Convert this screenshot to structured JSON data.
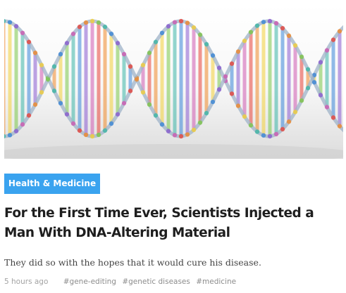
{
  "article": {
    "image_alt": "Rainbow colored DNA double helix",
    "image_colors": [
      "#e8433a",
      "#f08a2b",
      "#f3d13a",
      "#7cc84a",
      "#3cb6a8",
      "#3a86d9",
      "#8a5bd1",
      "#d05ab2"
    ],
    "category": "Health & Medicine",
    "headline": "For the First Time Ever, Scientists Injected a Man With DNA-Altering Material",
    "dek": "They did so with the hopes that it would cure his disease.",
    "time_ago": "5 hours ago",
    "tags": [
      "#gene-editing",
      "#genetic diseases",
      "#medicine"
    ]
  }
}
